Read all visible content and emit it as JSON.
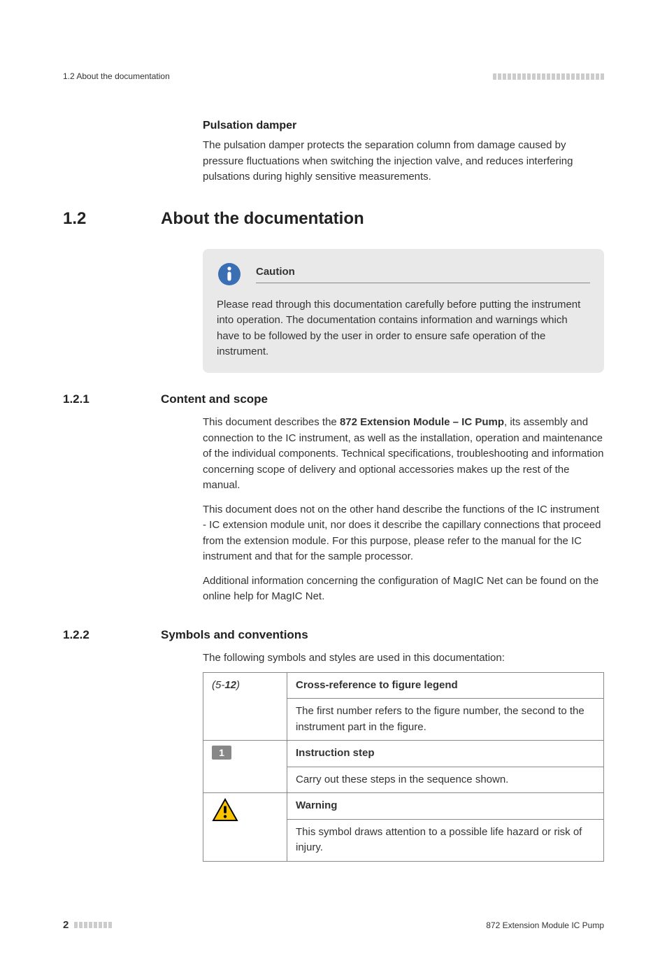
{
  "header": {
    "left": "1.2 About the documentation"
  },
  "pulsation": {
    "heading": "Pulsation damper",
    "text": "The pulsation damper protects the separation column from damage caused by pressure fluctuations when switching the injection valve, and reduces interfering pulsations during highly sensitive measurements."
  },
  "h1": {
    "num": "1.2",
    "text": "About the documentation"
  },
  "caution": {
    "label": "Caution",
    "text": "Please read through this documentation carefully before putting the instrument into operation. The documentation contains information and warnings which have to be followed by the user in order to ensure safe operation of the instrument."
  },
  "h2a": {
    "num": "1.2.1",
    "text": "Content and scope"
  },
  "content_scope": {
    "p1a": "This document describes the ",
    "p1b": "872 Extension Module – IC Pump",
    "p1c": ", its assembly and connection to the IC instrument, as well as the installation, operation and maintenance of the individual components. Technical specifications, troubleshooting and information concerning scope of delivery and optional accessories makes up the rest of the manual.",
    "p2": "This document does not on the other hand describe the functions of the IC instrument - IC extension module unit, nor does it describe the capillary connections that proceed from the extension module. For this purpose, please refer to the manual for the IC instrument and that for the sample processor.",
    "p3": "Additional information concerning the configuration of MagIC Net can be found on the online help for MagIC Net."
  },
  "h2b": {
    "num": "1.2.2",
    "text": "Symbols and conventions"
  },
  "symbols_intro": "The following symbols and styles are used in this documentation:",
  "table": {
    "row1": {
      "left_open": "(5-",
      "left_bold": "12",
      "left_close": ")",
      "title": "Cross-reference to figure legend",
      "desc": "The first number refers to the figure number, the second to the instrument part in the figure."
    },
    "row2": {
      "badge": "1",
      "title": "Instruction step",
      "desc": "Carry out these steps in the sequence shown."
    },
    "row3": {
      "title": "Warning",
      "desc": "This symbol draws attention to a possible life hazard or risk of injury."
    }
  },
  "footer": {
    "page": "2",
    "right": "872 Extension Module IC Pump"
  }
}
